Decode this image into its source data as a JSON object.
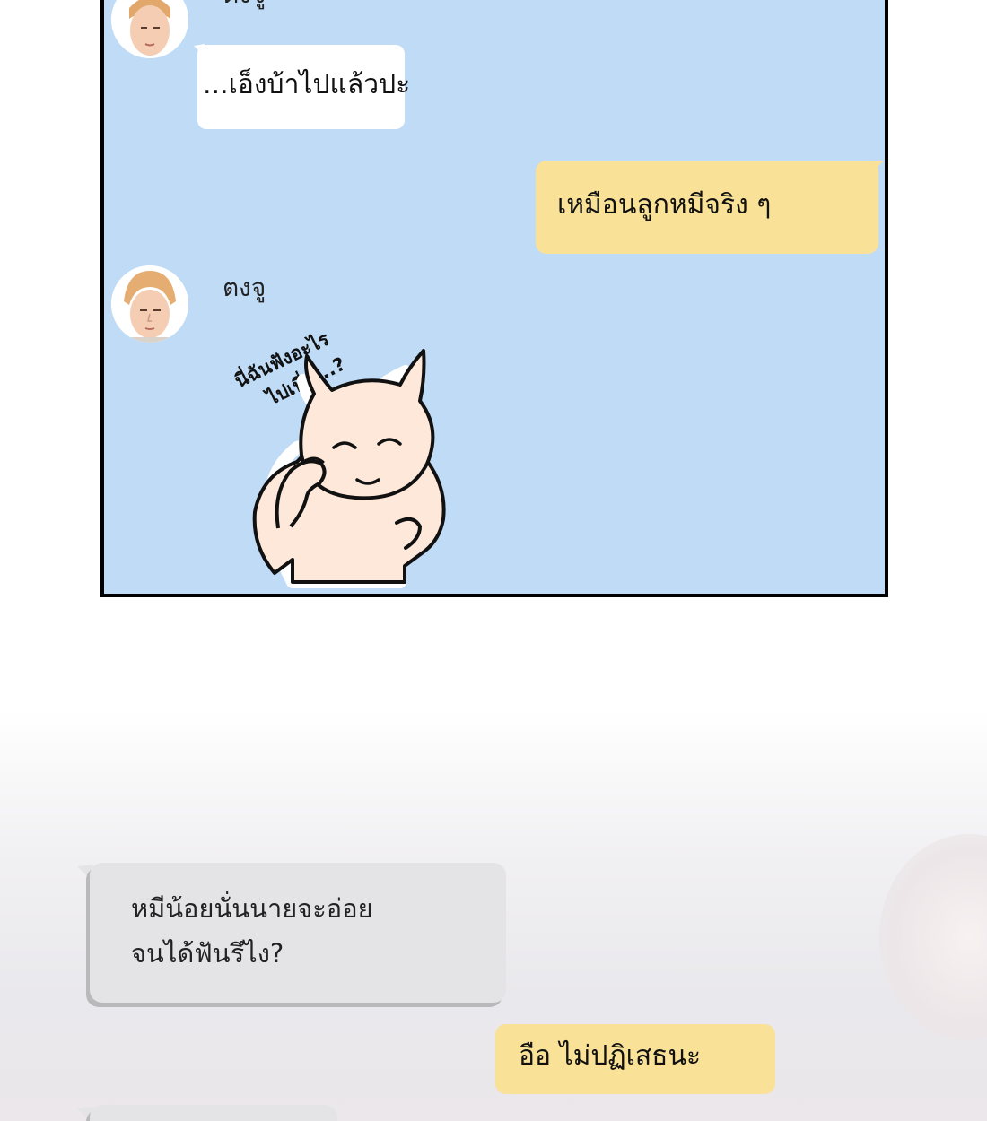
{
  "panel": {
    "messages": [
      {
        "sender": "ตงจู",
        "text": "...เอ็งบ้าไปแล้วปะ"
      },
      {
        "sender": "me",
        "text": "เหมือนลูกหมีจริง ๆ"
      },
      {
        "sender": "ตงจู",
        "sticker_caption_line1": "นี่ฉันฟังอะไร",
        "sticker_caption_line2": "ไปเนี่ย...?"
      }
    ]
  },
  "lower": {
    "gray_message_line1": "หมีน้อยนั่นนายจะอ่อย",
    "gray_message_line2": "จนได้ฟันรึไง?",
    "yellow_message": "อือ ไม่ปฏิเสธนะ"
  },
  "colors": {
    "panel_bg": "#bfdbf6",
    "yellow_bubble": "#f9e197",
    "gray_bubble": "#e4e4e6",
    "sticker_skin": "#fde8da"
  },
  "icons": [
    "avatar-icon",
    "bear-devil-sticker-icon"
  ]
}
